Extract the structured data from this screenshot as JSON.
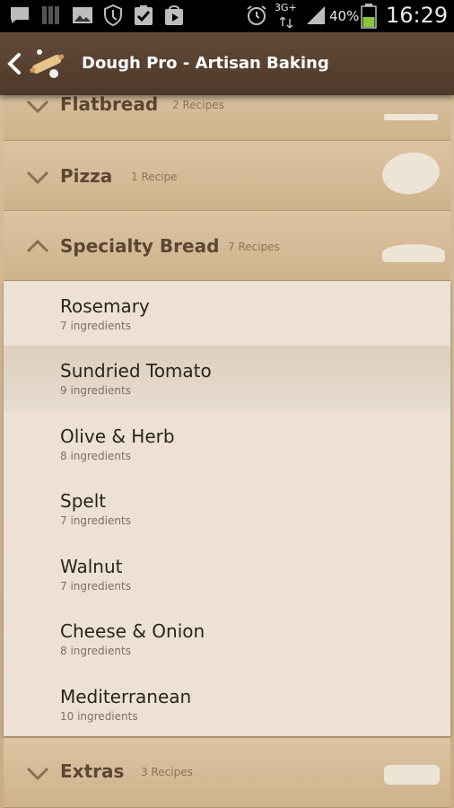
{
  "status_bar": {
    "network": "3G+",
    "battery_percent": "40%",
    "time": "16:29"
  },
  "action_bar": {
    "title": "Dough Pro - Artisan Baking"
  },
  "groups": [
    {
      "title": "Flatbread",
      "count": "2 Recipes",
      "expanded": false
    },
    {
      "title": "Pizza",
      "count": "1 Recipe",
      "expanded": false
    },
    {
      "title": "Specialty Bread",
      "count": "7 Recipes",
      "expanded": true
    },
    {
      "title": "Extras",
      "count": "3 Recipes",
      "expanded": false
    }
  ],
  "recipes": [
    {
      "name": "Rosemary",
      "ingredients": "7 ingredients"
    },
    {
      "name": "Sundried Tomato",
      "ingredients": "9 ingredients"
    },
    {
      "name": "Olive & Herb",
      "ingredients": "8 ingredients"
    },
    {
      "name": "Spelt",
      "ingredients": "7 ingredients"
    },
    {
      "name": "Walnut",
      "ingredients": "7 ingredients"
    },
    {
      "name": "Cheese & Onion",
      "ingredients": "8 ingredients"
    },
    {
      "name": "Mediterranean",
      "ingredients": "10 ingredients"
    }
  ],
  "colors": {
    "action_bar": "#4d392a",
    "group_header": "#d2b793",
    "child_bg": "#ece1d3",
    "group_title": "#5c4634"
  },
  "icons": {
    "status": [
      "message-icon",
      "signal-bars-icon",
      "image-icon",
      "shield-icon",
      "clipboard-check-icon",
      "play-store-icon",
      "alarm-icon",
      "cell-signal-icon",
      "battery-icon"
    ],
    "action_bar": [
      "back-chevron-icon",
      "rolling-pin-logo"
    ],
    "group": [
      "chevron-down-icon",
      "chevron-up-icon"
    ]
  }
}
